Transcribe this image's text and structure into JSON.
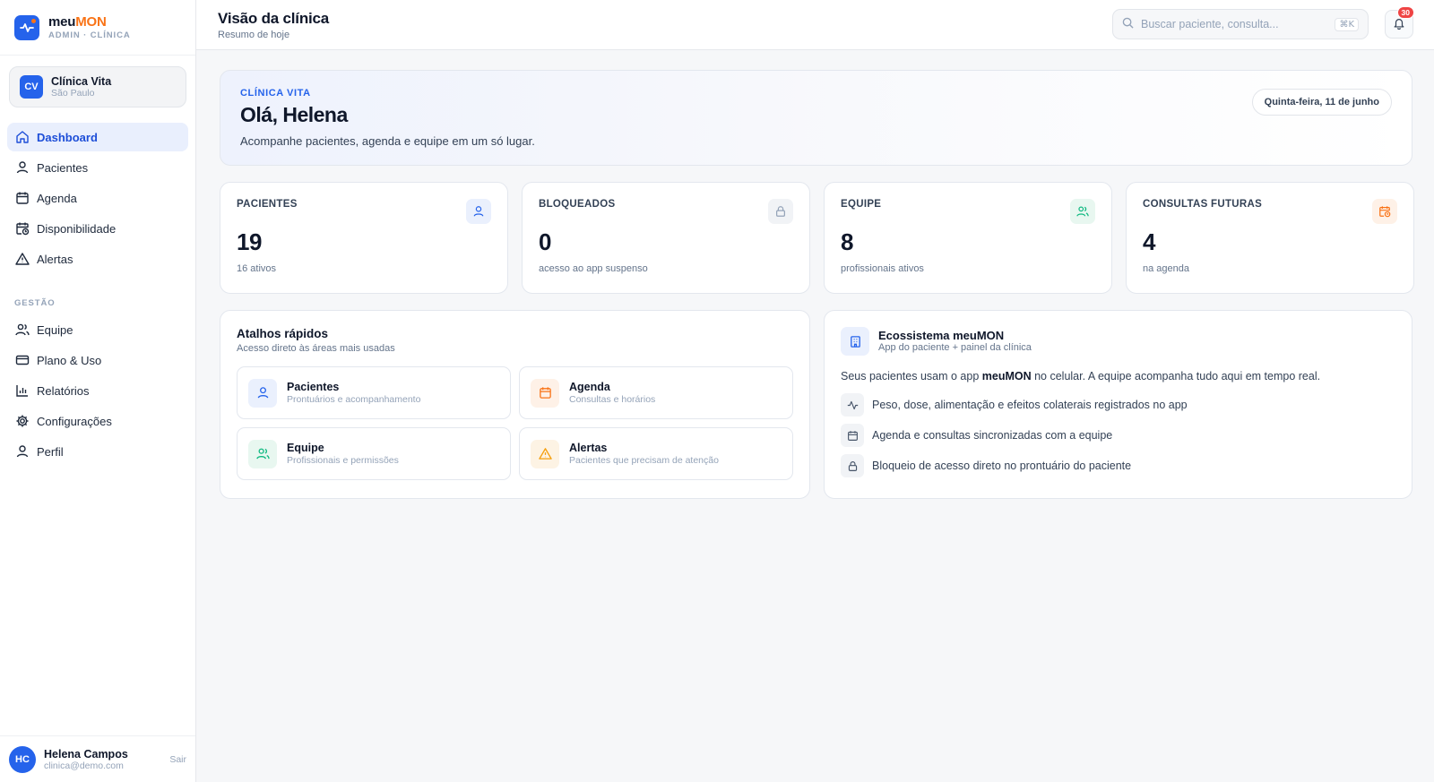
{
  "brand": {
    "name_prefix": "meu",
    "name_accent": "MON",
    "subtitle": "ADMIN · CLÍNICA"
  },
  "clinic": {
    "initials": "CV",
    "name": "Clínica Vita",
    "city": "São Paulo"
  },
  "nav": {
    "items": [
      {
        "label": "Dashboard",
        "icon": "home-icon",
        "active": true
      },
      {
        "label": "Pacientes",
        "icon": "user-icon"
      },
      {
        "label": "Agenda",
        "icon": "calendar-icon"
      },
      {
        "label": "Disponibilidade",
        "icon": "calendar-clock-icon"
      },
      {
        "label": "Alertas",
        "icon": "alert-triangle-icon"
      }
    ],
    "section_label": "GESTÃO",
    "management": [
      {
        "label": "Equipe",
        "icon": "users-icon"
      },
      {
        "label": "Plano & Uso",
        "icon": "credit-card-icon"
      },
      {
        "label": "Relatórios",
        "icon": "bar-chart-icon"
      },
      {
        "label": "Configurações",
        "icon": "gear-icon"
      },
      {
        "label": "Perfil",
        "icon": "user-icon"
      }
    ]
  },
  "user": {
    "initials": "HC",
    "name": "Helena Campos",
    "email": "clinica@demo.com",
    "logout": "Sair"
  },
  "header": {
    "title": "Visão da clínica",
    "subtitle": "Resumo de hoje"
  },
  "search": {
    "placeholder": "Buscar paciente, consulta...",
    "shortcut": "⌘K"
  },
  "notifications": {
    "count": "30"
  },
  "hero": {
    "eyebrow": "CLÍNICA VITA",
    "greeting": "Olá, Helena",
    "description": "Acompanhe pacientes, agenda e equipe em um só lugar.",
    "date": "Quinta-feira, 11 de junho"
  },
  "stats": [
    {
      "label": "PACIENTES",
      "value": "19",
      "sub": "16 ativos",
      "icon": "user-icon",
      "color": "#2563eb"
    },
    {
      "label": "BLOQUEADOS",
      "value": "0",
      "sub": "acesso ao app suspenso",
      "icon": "lock-icon",
      "color": "#94a3b8"
    },
    {
      "label": "EQUIPE",
      "value": "8",
      "sub": "profissionais ativos",
      "icon": "users-icon",
      "color": "#10b981"
    },
    {
      "label": "CONSULTAS FUTURAS",
      "value": "4",
      "sub": "na agenda",
      "icon": "calendar-clock-icon",
      "color": "#f97316"
    }
  ],
  "shortcuts": {
    "title": "Atalhos rápidos",
    "subtitle": "Acesso direto às áreas mais usadas",
    "items": [
      {
        "title": "Pacientes",
        "desc": "Prontuários e acompanhamento",
        "icon": "user-icon"
      },
      {
        "title": "Agenda",
        "desc": "Consultas e horários",
        "icon": "calendar-icon"
      },
      {
        "title": "Equipe",
        "desc": "Profissionais e permissões",
        "icon": "users-icon"
      },
      {
        "title": "Alertas",
        "desc": "Pacientes que precisam de atenção",
        "icon": "alert-triangle-icon"
      }
    ]
  },
  "ecosystem": {
    "title": "Ecossistema meuMON",
    "subtitle": "App do paciente + painel da clínica",
    "desc_before": "Seus pacientes usam o app ",
    "desc_bold": "meuMON",
    "desc_after": " no celular. A equipe acompanha tudo aqui em tempo real.",
    "items": [
      {
        "text": "Peso, dose, alimentação e efeitos colaterais registrados no app",
        "icon": "activity-icon"
      },
      {
        "text": "Agenda e consultas sincronizadas com a equipe",
        "icon": "calendar-icon"
      },
      {
        "text": "Bloqueio de acesso direto no prontuário do paciente",
        "icon": "lock-icon"
      }
    ]
  },
  "colors": {
    "primary": "#2563eb",
    "accent": "#f97316",
    "success": "#10b981",
    "danger": "#ef4444"
  }
}
